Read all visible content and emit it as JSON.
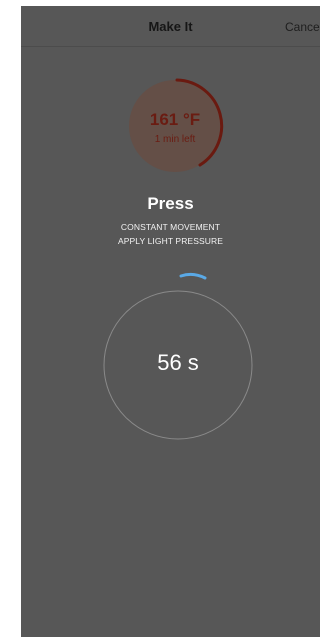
{
  "nav": {
    "title": "Make It",
    "cancel_label": "Cancel"
  },
  "temperature": {
    "value": "161 °F",
    "time_left": "1 min left"
  },
  "step": {
    "title": "Press",
    "instruction_line_1": "CONSTANT MOVEMENT",
    "instruction_line_2": "APPLY LIGHT PRESSURE"
  },
  "timer": {
    "label": "56 s"
  },
  "colors": {
    "overlay": "#575757",
    "accent_red": "#6a1c12",
    "spinner_blue": "#5aa9e6",
    "text_white": "#ffffff"
  },
  "icons": {
    "temperature_ring": "progress-ring-icon",
    "spinner": "loading-spinner-icon"
  }
}
